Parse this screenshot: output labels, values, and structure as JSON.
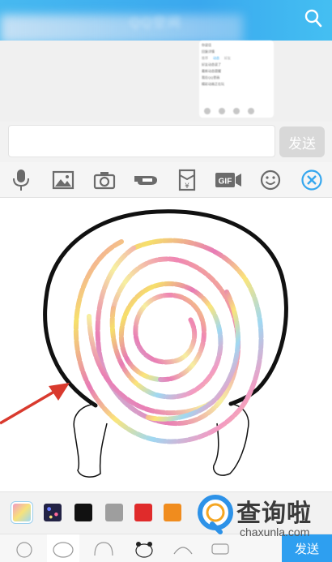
{
  "header": {
    "title": "QQ空间",
    "search_icon": "search-icon"
  },
  "chat_preview": {
    "lines": [
      "你说话",
      "回复详情",
      "",
      "资讯",
      "最新",
      "好友动态说了",
      "最新动态提醒",
      "我在QQ里画"
    ],
    "tabs": [
      "推荐",
      "动态",
      "好友"
    ],
    "active_tab": "动态",
    "footer": "精彩动画正在玩"
  },
  "input": {
    "value": "",
    "placeholder": "",
    "send_label": "发送"
  },
  "toolbar": {
    "items": [
      {
        "name": "microphone-icon",
        "label": "语音"
      },
      {
        "name": "image-icon",
        "label": "图片"
      },
      {
        "name": "camera-icon",
        "label": "相机"
      },
      {
        "name": "poke-icon",
        "label": "戳一戳"
      },
      {
        "name": "red-packet-icon",
        "label": "红包"
      },
      {
        "name": "gif-icon",
        "label": "GIF"
      },
      {
        "name": "emoji-icon",
        "label": "表情"
      },
      {
        "name": "close-icon",
        "label": "关闭"
      }
    ]
  },
  "palette": {
    "colors": [
      "rainbow",
      "glitter",
      "#111111",
      "#9e9e9e",
      "#e02b2b",
      "#f08c1e"
    ],
    "selected": "rainbow"
  },
  "bottom_bar": {
    "send_label": "发送",
    "tabs": [
      "face-1",
      "face-2",
      "face-3",
      "face-panda",
      "face-4",
      "face-5"
    ]
  },
  "watermark": {
    "text": "查询啦",
    "url": "chaxunla.com"
  },
  "colors": {
    "header_blue": "#3aa8ee",
    "send_blue": "#2e9ff0",
    "close_blue": "#36a7ee",
    "arrow_red": "#d93a2e"
  }
}
